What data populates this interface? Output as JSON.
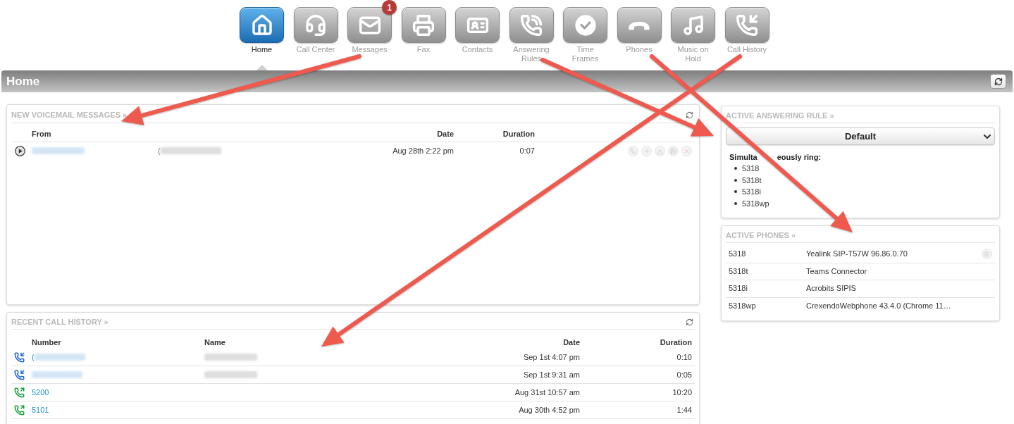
{
  "nav": [
    {
      "kind": "home",
      "label": "Home",
      "selected": true
    },
    {
      "kind": "callcenter",
      "label": "Call Center",
      "selected": false
    },
    {
      "kind": "messages",
      "label": "Messages",
      "selected": false,
      "badge": "1"
    },
    {
      "kind": "fax",
      "label": "Fax",
      "selected": false
    },
    {
      "kind": "contacts",
      "label": "Contacts",
      "selected": false
    },
    {
      "kind": "rules",
      "label": "Answering Rules",
      "selected": false
    },
    {
      "kind": "timeframes",
      "label": "Time Frames",
      "selected": false
    },
    {
      "kind": "phones",
      "label": "Phones",
      "selected": false
    },
    {
      "kind": "music",
      "label": "Music on Hold",
      "selected": false
    },
    {
      "kind": "history",
      "label": "Call History",
      "selected": false
    }
  ],
  "page_title": "Home",
  "voicemail": {
    "title": "NEW VOICEMAIL MESSAGES »",
    "columns": [
      "From",
      "Date",
      "Duration"
    ],
    "rows": [
      {
        "from_blurred": true,
        "caller": "(",
        "caller_blurred": true,
        "date": "Aug 28th 2:22 pm",
        "duration": "0:07"
      }
    ]
  },
  "call_history": {
    "title": "RECENT CALL HISTORY »",
    "columns": [
      "Number",
      "Name",
      "Date",
      "Duration"
    ],
    "rows": [
      {
        "kind": "incoming",
        "number": "(",
        "number_blurred": true,
        "name_blurred": true,
        "date": "Sep 1st 4:07 pm",
        "duration": "0:10"
      },
      {
        "kind": "incoming",
        "number_blurred": true,
        "name_blurred": true,
        "date": "Sep 1st 9:31 am",
        "duration": "0:05"
      },
      {
        "kind": "outgoing",
        "number": "5200",
        "number_blurred": false,
        "name_blurred": false,
        "date": "Aug 31st 10:57 am",
        "duration": "10:20"
      },
      {
        "kind": "outgoing",
        "number": "5101",
        "number_blurred": false,
        "name_blurred": false,
        "date": "Aug 30th 4:52 pm",
        "duration": "1:44"
      }
    ]
  },
  "answering_rule": {
    "title": "ACTIVE ANSWERING RULE »",
    "rule_select": {
      "value": "Default"
    },
    "ring_label": {
      "before_arrow": "Simulta",
      "after_arrow": "eously ring:"
    },
    "ring_list": [
      "5318",
      "5318t",
      "5318i",
      "5318wp"
    ]
  },
  "active_phones": {
    "title": "ACTIVE PHONES »",
    "rows": [
      {
        "extension": "5318",
        "device": "Yealink SIP-T57W 96.86.0.70",
        "settings": true
      },
      {
        "extension": "5318t",
        "device": "Teams Connector",
        "settings": false
      },
      {
        "extension": "5318i",
        "device": "Acrobits SIPIS",
        "settings": false
      },
      {
        "extension": "5318wp",
        "device": "CrexendoWebphone 43.4.0 (Chrome 11…",
        "settings": false
      }
    ]
  }
}
